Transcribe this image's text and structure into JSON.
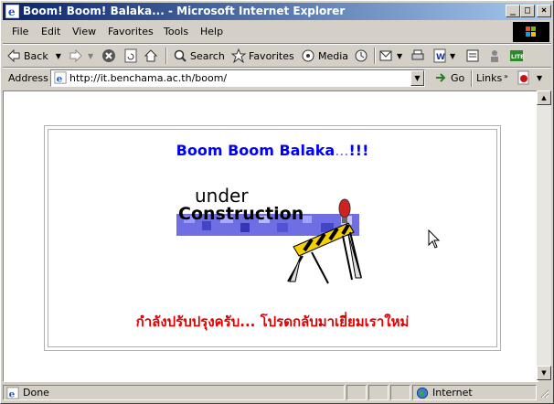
{
  "window": {
    "title": "Boom! Boom! Balaka... - Microsoft Internet Explorer"
  },
  "menu": [
    "File",
    "Edit",
    "View",
    "Favorites",
    "Tools",
    "Help"
  ],
  "toolbar": {
    "back": "Back",
    "search": "Search",
    "favorites": "Favorites",
    "media": "Media"
  },
  "address": {
    "label": "Address",
    "url": "http://it.benchama.ac.th/boom/",
    "go": "Go",
    "links": "Links"
  },
  "page": {
    "heading_main": "Boom Boom Balaka",
    "heading_dots": "...",
    "heading_excl": "!!!",
    "banner_line1": "under",
    "banner_line2": "Construction",
    "thai_message": "กำลังปรับปรุงครับ... โปรดกลับมาเยี่ยมเราใหม่"
  },
  "status": {
    "text": "Done",
    "zone": "Internet"
  },
  "colors": {
    "heading": "#0000ff",
    "thai": "#e00000",
    "titlebar_start": "#0a246a",
    "titlebar_end": "#a6caf0"
  }
}
